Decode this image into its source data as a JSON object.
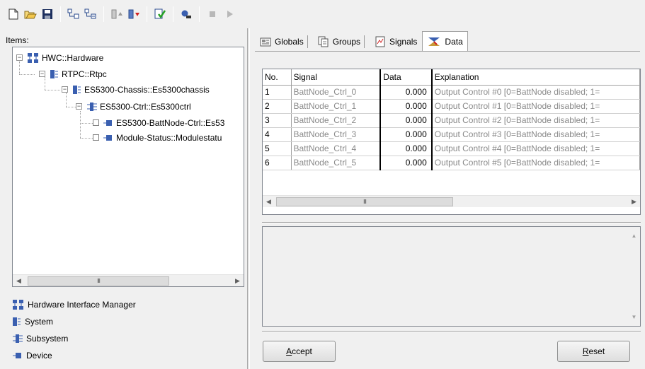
{
  "toolbar": {
    "buttons": [
      "new-icon",
      "open-icon",
      "save-icon",
      "tree-expand-icon",
      "tree-collapse-icon",
      "move-up-icon",
      "move-down-icon",
      "check-icon",
      "connect-icon",
      "stop-icon",
      "play-icon"
    ]
  },
  "left_pane": {
    "items_label": "Items:",
    "tree": [
      {
        "label": "HWC::Hardware",
        "type": "hardware"
      },
      {
        "label": "RTPC::Rtpc",
        "type": "system"
      },
      {
        "label": "ES5300-Chassis::Es5300chassis",
        "type": "system"
      },
      {
        "label": "ES5300-Ctrl::Es5300ctrl",
        "type": "subsystem"
      },
      {
        "label": "ES5300-BattNode-Ctrl::Es53",
        "type": "device"
      },
      {
        "label": "Module-Status::Modulestatu",
        "type": "device"
      }
    ],
    "legend": [
      {
        "label": "Hardware Interface Manager",
        "icon": "hardware-icon"
      },
      {
        "label": "System",
        "icon": "system-icon"
      },
      {
        "label": "Subsystem",
        "icon": "subsystem-icon"
      },
      {
        "label": "Device",
        "icon": "device-icon"
      }
    ],
    "scroll_thumb": "III"
  },
  "tabs": [
    {
      "label": "Globals",
      "icon": "globals-icon"
    },
    {
      "label": "Groups",
      "icon": "groups-icon"
    },
    {
      "label": "Signals",
      "icon": "signals-icon"
    },
    {
      "label": "Data",
      "icon": "data-icon",
      "active": true
    }
  ],
  "grid": {
    "headers": [
      "No.",
      "Signal",
      "Data",
      "Explanation"
    ],
    "rows": [
      [
        "1",
        "BattNode_Ctrl_0",
        "0.000",
        "Output Control #0 [0=BattNode disabled; 1="
      ],
      [
        "2",
        "BattNode_Ctrl_1",
        "0.000",
        "Output Control #1 [0=BattNode disabled; 1="
      ],
      [
        "3",
        "BattNode_Ctrl_2",
        "0.000",
        "Output Control #2 [0=BattNode disabled; 1="
      ],
      [
        "4",
        "BattNode_Ctrl_3",
        "0.000",
        "Output Control #3 [0=BattNode disabled; 1="
      ],
      [
        "5",
        "BattNode_Ctrl_4",
        "0.000",
        "Output Control #4 [0=BattNode disabled; 1="
      ],
      [
        "6",
        "BattNode_Ctrl_5",
        "0.000",
        "Output Control #5 [0=BattNode disabled; 1="
      ]
    ],
    "scroll_thumb": "III"
  },
  "buttons": {
    "accept_prefix": "A",
    "accept_rest": "ccept",
    "reset_prefix": "R",
    "reset_rest": "eset"
  }
}
